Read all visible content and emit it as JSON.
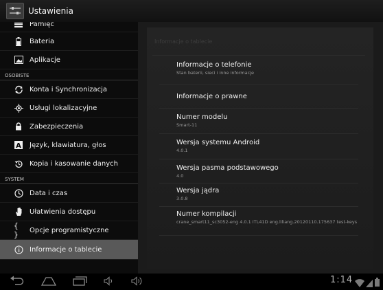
{
  "app": {
    "title": "Ustawienia"
  },
  "sidebar": {
    "items_top": [
      {
        "label": "Pamięć",
        "icon": "storage-icon"
      },
      {
        "label": "Bateria",
        "icon": "battery-icon"
      },
      {
        "label": "Aplikacje",
        "icon": "apps-icon"
      }
    ],
    "header_personal": "OSOBISTE",
    "items_personal": [
      {
        "label": "Konta i Synchronizacja",
        "icon": "sync-icon"
      },
      {
        "label": "Usługi lokalizacyjne",
        "icon": "location-icon"
      },
      {
        "label": "Zabezpieczenia",
        "icon": "lock-icon"
      },
      {
        "label": "Język, klawiatura, głos",
        "icon": "language-icon"
      },
      {
        "label": "Kopia i kasowanie danych",
        "icon": "backup-icon"
      }
    ],
    "header_system": "SYSTEM",
    "items_system": [
      {
        "label": "Data i czas",
        "icon": "clock-icon"
      },
      {
        "label": "Ułatwienia dostępu",
        "icon": "hand-icon"
      },
      {
        "label": "Opcje programistyczne",
        "icon": "braces-icon"
      },
      {
        "label": "Informacje o tablecie",
        "icon": "info-icon"
      }
    ]
  },
  "detail": {
    "title": "Informacje o tablecie",
    "items": [
      {
        "title": "Informacje o telefonie",
        "summary": "Stan baterii, sieci i inne informacje"
      },
      {
        "title": "Informacje o prawne",
        "summary": ""
      },
      {
        "title": "Numer modelu",
        "summary": "Smart-11"
      },
      {
        "title": "Wersja systemu Android",
        "summary": "4.0.1"
      },
      {
        "title": "Wersja pasma podstawowego",
        "summary": "4.0"
      },
      {
        "title": "Wersja jądra",
        "summary": "3.0.8"
      },
      {
        "title": "Numer kompilacji",
        "summary": "crane_smart11_sc3052-eng 4.0.1 ITL41D eng.liliang.20120110.175637 test-keys"
      }
    ]
  },
  "statusbar": {
    "time": "1:14"
  },
  "colors": {
    "selected": "#595959",
    "background": "#1b1b1b"
  }
}
